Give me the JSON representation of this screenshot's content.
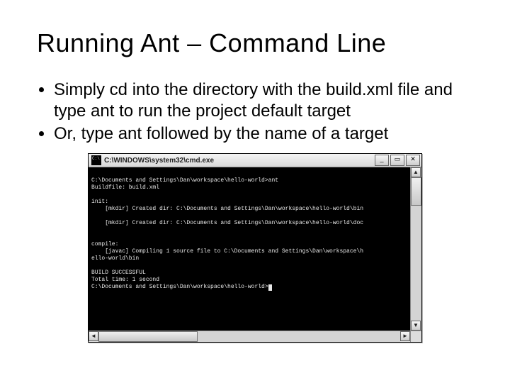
{
  "title": "Running Ant – Command Line",
  "bullets": [
    "Simply cd into the directory with the build.xml file and type ant to run the project default target",
    "Or, type ant followed by the name of a target"
  ],
  "cmd": {
    "window_title": "C:\\WINDOWS\\system32\\cmd.exe",
    "buttons": {
      "min": "_",
      "max": "▭",
      "close": "✕"
    },
    "scroll": {
      "up": "▲",
      "down": "▼",
      "left": "◄",
      "right": "►"
    },
    "lines": [
      "",
      "C:\\Documents and Settings\\Dan\\workspace\\hello-world>ant",
      "Buildfile: build.xml",
      "",
      "init:",
      "    [mkdir] Created dir: C:\\Documents and Settings\\Dan\\workspace\\hello-world\\bin",
      "",
      "    [mkdir] Created dir: C:\\Documents and Settings\\Dan\\workspace\\hello-world\\doc",
      "",
      "",
      "compile:",
      "    [javac] Compiling 1 source file to C:\\Documents and Settings\\Dan\\workspace\\h",
      "ello-world\\bin",
      "",
      "BUILD SUCCESSFUL",
      "Total time: 1 second",
      "C:\\Documents and Settings\\Dan\\workspace\\hello-world>"
    ]
  }
}
